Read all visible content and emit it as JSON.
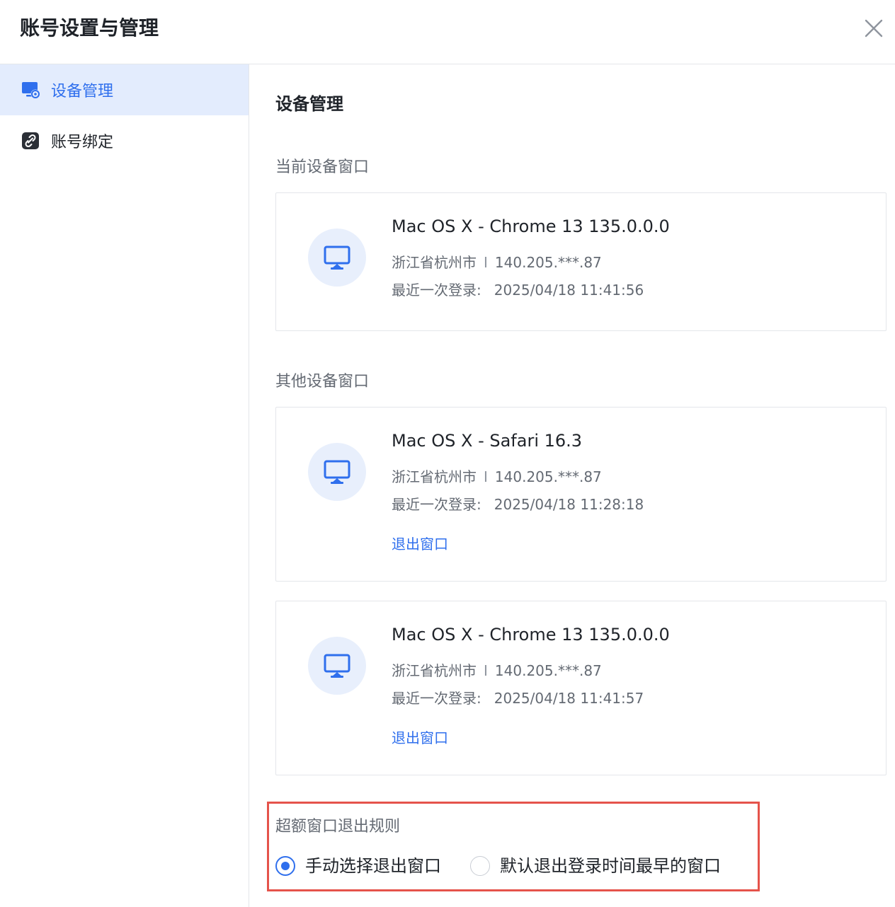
{
  "header": {
    "title": "账号设置与管理"
  },
  "sidebar": {
    "items": [
      {
        "label": "设备管理",
        "icon": "device-settings-icon",
        "active": true
      },
      {
        "label": "账号绑定",
        "icon": "link-icon",
        "active": false
      }
    ]
  },
  "main": {
    "title": "设备管理",
    "current_section": {
      "label": "当前设备窗口",
      "device": {
        "name": "Mac OS X - Chrome 13 135.0.0.0",
        "location": "浙江省杭州市",
        "separator": "I",
        "ip": "140.205.***.87",
        "last_login_label": "最近一次登录:",
        "last_login": "2025/04/18 11:41:56"
      }
    },
    "other_section": {
      "label": "其他设备窗口",
      "devices": [
        {
          "name": "Mac OS X - Safari 16.3",
          "location": "浙江省杭州市",
          "separator": "I",
          "ip": "140.205.***.87",
          "last_login_label": "最近一次登录:",
          "last_login": "2025/04/18 11:28:18",
          "action": "退出窗口"
        },
        {
          "name": "Mac OS X - Chrome 13 135.0.0.0",
          "location": "浙江省杭州市",
          "separator": "I",
          "ip": "140.205.***.87",
          "last_login_label": "最近一次登录:",
          "last_login": "2025/04/18 11:41:57",
          "action": "退出窗口"
        }
      ]
    },
    "rule": {
      "title": "超额窗口退出规则",
      "options": [
        {
          "label": "手动选择退出窗口",
          "checked": true
        },
        {
          "label": "默认退出登录时间最早的窗口",
          "checked": false
        }
      ]
    }
  },
  "colors": {
    "accent": "#2f6fed",
    "highlight_border": "#e5534b",
    "sidebar_active_bg": "#e3ecfd",
    "device_icon_bg": "#e8effc"
  }
}
